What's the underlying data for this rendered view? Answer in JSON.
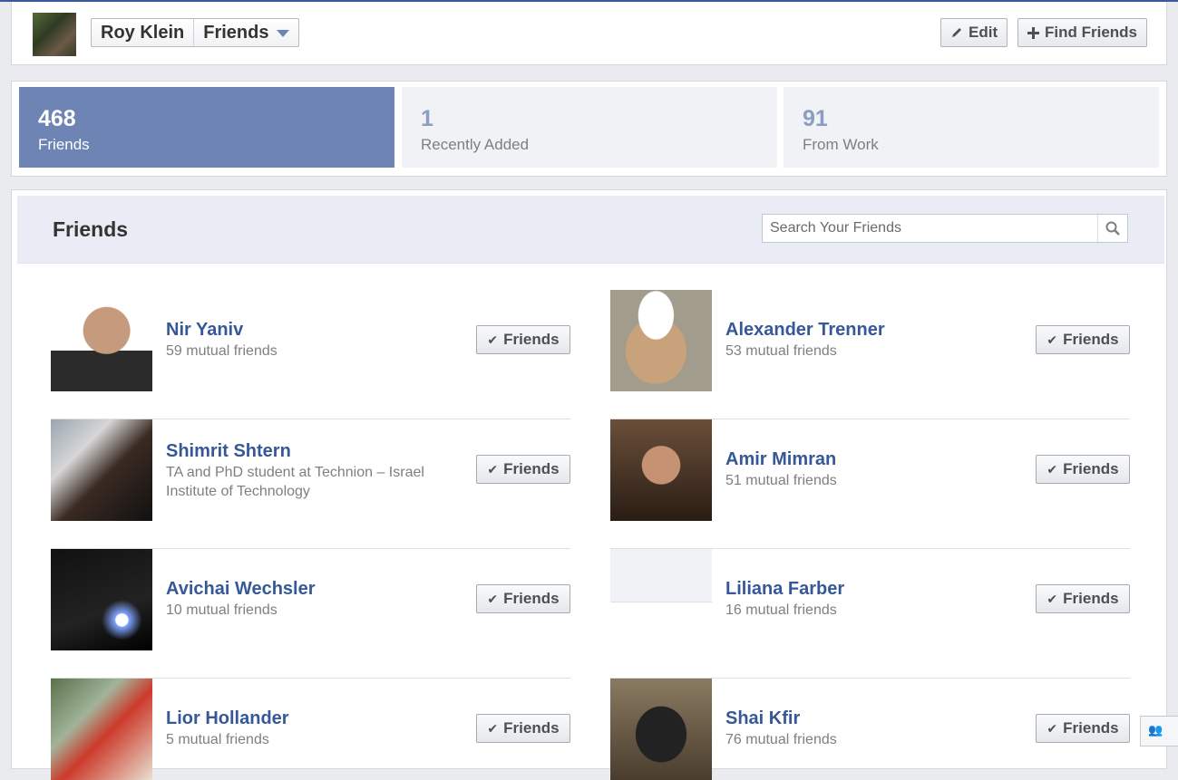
{
  "header": {
    "name": "Roy Klein",
    "section": "Friends",
    "edit_label": "Edit",
    "find_friends_label": "Find Friends"
  },
  "stats": [
    {
      "count": "468",
      "label": "Friends"
    },
    {
      "count": "1",
      "label": "Recently Added"
    },
    {
      "count": "91",
      "label": "From Work"
    }
  ],
  "friends_panel": {
    "title": "Friends",
    "search_placeholder": "Search Your Friends",
    "friend_button_label": "Friends",
    "friends": [
      {
        "name": "Nir Yaniv",
        "sub": "59 mutual friends"
      },
      {
        "name": "Alexander Trenner",
        "sub": "53 mutual friends"
      },
      {
        "name": "Shimrit Shtern",
        "sub": "TA and PhD student at Technion – Israel Institute of Technology"
      },
      {
        "name": "Amir Mimran",
        "sub": "51 mutual friends"
      },
      {
        "name": "Avichai Wechsler",
        "sub": "10 mutual friends"
      },
      {
        "name": "Liliana Farber",
        "sub": "16 mutual friends"
      },
      {
        "name": "Lior Hollander",
        "sub": "5 mutual friends"
      },
      {
        "name": "Shai Kfir",
        "sub": "76 mutual friends"
      }
    ]
  },
  "icons": {
    "edit": "pencil-icon",
    "find": "plus-icon",
    "dropdown": "caret-down-icon",
    "search": "magnifier-icon",
    "friends_button": "check-icon",
    "chat": "chat-icon"
  },
  "colors": {
    "brand": "#3b5998",
    "link": "#365899",
    "active_stat": "#6d84b4",
    "panel_header": "#e9ecf4"
  }
}
